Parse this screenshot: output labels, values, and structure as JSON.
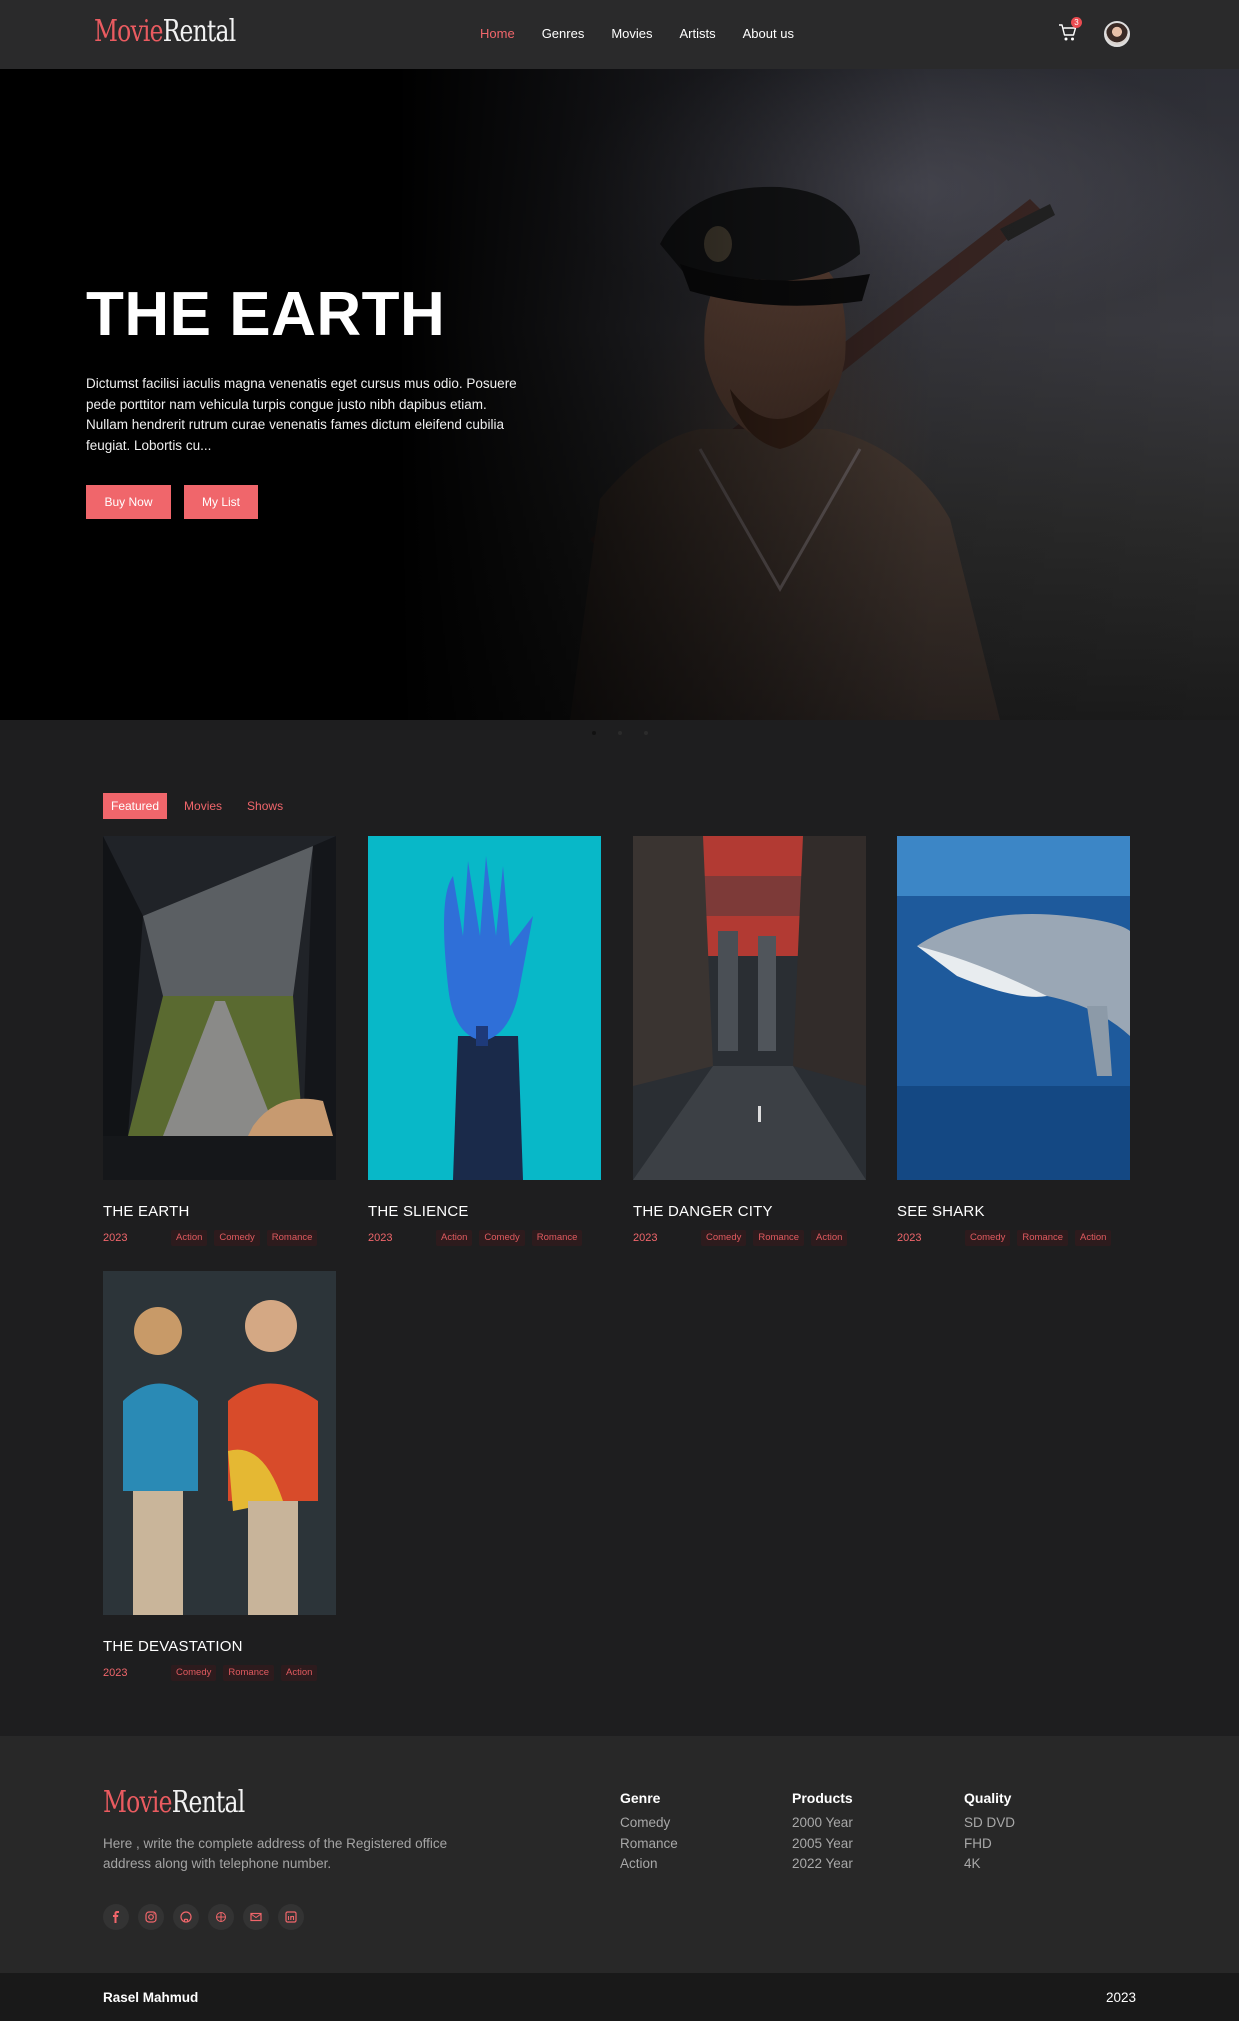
{
  "brand": {
    "part1": "Movie",
    "part2": "Rental"
  },
  "nav": {
    "items": [
      "Home",
      "Genres",
      "Movies",
      "Artists",
      "About us"
    ],
    "active": "Home"
  },
  "cart": {
    "count": "3",
    "icon": "cart-icon"
  },
  "hero": {
    "title": "THE EARTH",
    "description": "Dictumst facilisi iaculis magna venenatis eget cursus mus odio. Posuere pede porttitor nam vehicula turpis congue justo nibh dapibus etiam. Nullam hendrerit rutrum curae venenatis fames dictum eleifend cubilia feugiat. Lobortis cu...",
    "buy_label": "Buy Now",
    "list_label": "My List"
  },
  "tabs": {
    "items": [
      "Featured",
      "Movies",
      "Shows"
    ],
    "active": "Featured"
  },
  "movies": [
    {
      "title": "THE EARTH",
      "year": "2023",
      "tags": [
        "Action",
        "Comedy",
        "Romance"
      ]
    },
    {
      "title": "THE SLIENCE",
      "year": "2023",
      "tags": [
        "Action",
        "Comedy",
        "Romance"
      ]
    },
    {
      "title": "THE DANGER CITY",
      "year": "2023",
      "tags": [
        "Comedy",
        "Romance",
        "Action"
      ]
    },
    {
      "title": "SEE SHARK",
      "year": "2023",
      "tags": [
        "Comedy",
        "Romance",
        "Action"
      ]
    },
    {
      "title": "THE DEVASTATION",
      "year": "2023",
      "tags": [
        "Comedy",
        "Romance",
        "Action"
      ]
    }
  ],
  "footer": {
    "address": "Here , write the complete address of the Registered office address along with telephone number.",
    "socials": [
      "facebook-icon",
      "instagram-icon",
      "github-icon",
      "web-icon",
      "mail-icon",
      "linkedin-icon"
    ],
    "columns": [
      {
        "heading": "Genre",
        "items": [
          "Comedy",
          "Romance",
          "Action"
        ]
      },
      {
        "heading": "Products",
        "items": [
          "2000 Year",
          "2005 Year",
          "2022 Year"
        ]
      },
      {
        "heading": "Quality",
        "items": [
          "SD DVD",
          "FHD",
          "4K"
        ]
      }
    ]
  },
  "bottom": {
    "name": "Rasel Mahmud",
    "year": "2023"
  },
  "colors": {
    "accent": "#f0666b",
    "background": "#1e1e1f",
    "header": "#2a2a2b"
  }
}
